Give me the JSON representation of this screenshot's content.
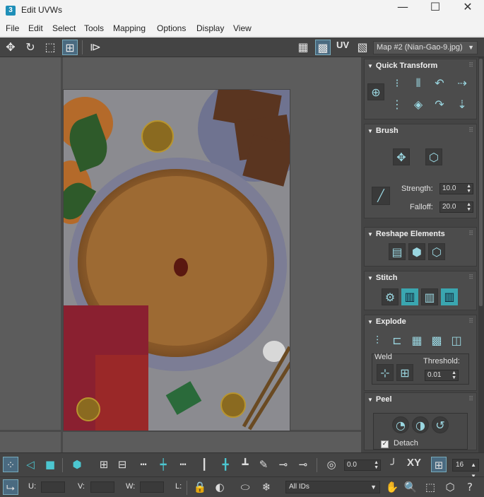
{
  "window": {
    "app_icon": "3",
    "title": "Edit UVWs",
    "minimize": "—",
    "maximize": "☐",
    "close": "✕"
  },
  "menu": [
    "File",
    "Edit",
    "Select",
    "Tools",
    "Mapping",
    "Options",
    "Display",
    "View"
  ],
  "toolbar_top": {
    "uv_label": "UV",
    "map_selector": "Map #2 (Nian-Gao-9.jpg)"
  },
  "panel": {
    "quick_transform": {
      "title": "Quick Transform"
    },
    "brush": {
      "title": "Brush",
      "strength_label": "Strength:",
      "strength_value": "10.0",
      "falloff_label": "Falloff:",
      "falloff_value": "20.0"
    },
    "reshape": {
      "title": "Reshape Elements"
    },
    "stitch": {
      "title": "Stitch"
    },
    "explode": {
      "title": "Explode",
      "weld_label": "Weld",
      "threshold_label": "Threshold:",
      "threshold_value": "0.01"
    },
    "peel": {
      "title": "Peel",
      "detach_label": "Detach",
      "detach_checked": true
    }
  },
  "bottom_bar": {
    "angle_value": "0.0",
    "xy_label": "XY",
    "grid_value": "16",
    "u_label": "U:",
    "v_label": "V:",
    "w_label": "W:",
    "l_label": "L:",
    "ids_select": "All IDs"
  },
  "colors": {
    "toolbar_bg": "#444444",
    "accent_teal": "#3aa6b0",
    "viewport_bg": "#5c5c5c"
  }
}
